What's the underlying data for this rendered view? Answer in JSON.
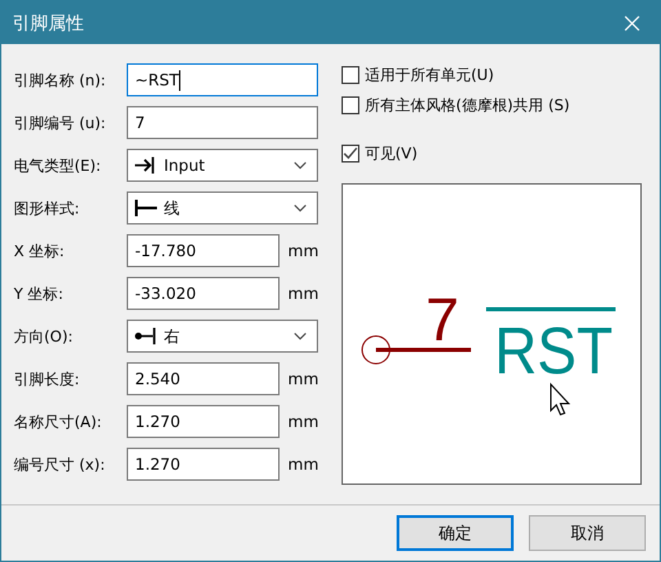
{
  "window": {
    "title": "引脚属性"
  },
  "fields": [
    {
      "kind": "text",
      "label": "引脚名称 (n):",
      "value": "~RST",
      "focused": true
    },
    {
      "kind": "text",
      "label": "引脚编号 (u):",
      "value": "7",
      "focused": false
    },
    {
      "kind": "select",
      "label": "电气类型(E):",
      "value": "Input"
    },
    {
      "kind": "select",
      "label": "图形样式:",
      "value": "线"
    },
    {
      "kind": "unit",
      "label": "X 坐标:",
      "value": "-17.780",
      "unit": "mm"
    },
    {
      "kind": "unit",
      "label": "Y 坐标:",
      "value": "-33.020",
      "unit": "mm"
    },
    {
      "kind": "select",
      "label": "方向(O):",
      "value": "右"
    },
    {
      "kind": "unit",
      "label": "引脚长度:",
      "value": "2.540",
      "unit": "mm"
    },
    {
      "kind": "unit",
      "label": "名称尺寸(A):",
      "value": "1.270",
      "unit": "mm"
    },
    {
      "kind": "unit",
      "label": "编号尺寸 (x):",
      "value": "1.270",
      "unit": "mm"
    }
  ],
  "checkboxes": [
    {
      "label": "适用于所有单元(U)",
      "checked": false
    },
    {
      "label": "所有主体风格(德摩根)共用 (S)",
      "checked": false
    },
    {
      "label": "可见(V)",
      "checked": true
    }
  ],
  "preview": {
    "number": "7",
    "name": "RST",
    "name_overline": true
  },
  "buttons": [
    {
      "label": "确定",
      "default": true
    },
    {
      "label": "取消",
      "default": false
    }
  ]
}
